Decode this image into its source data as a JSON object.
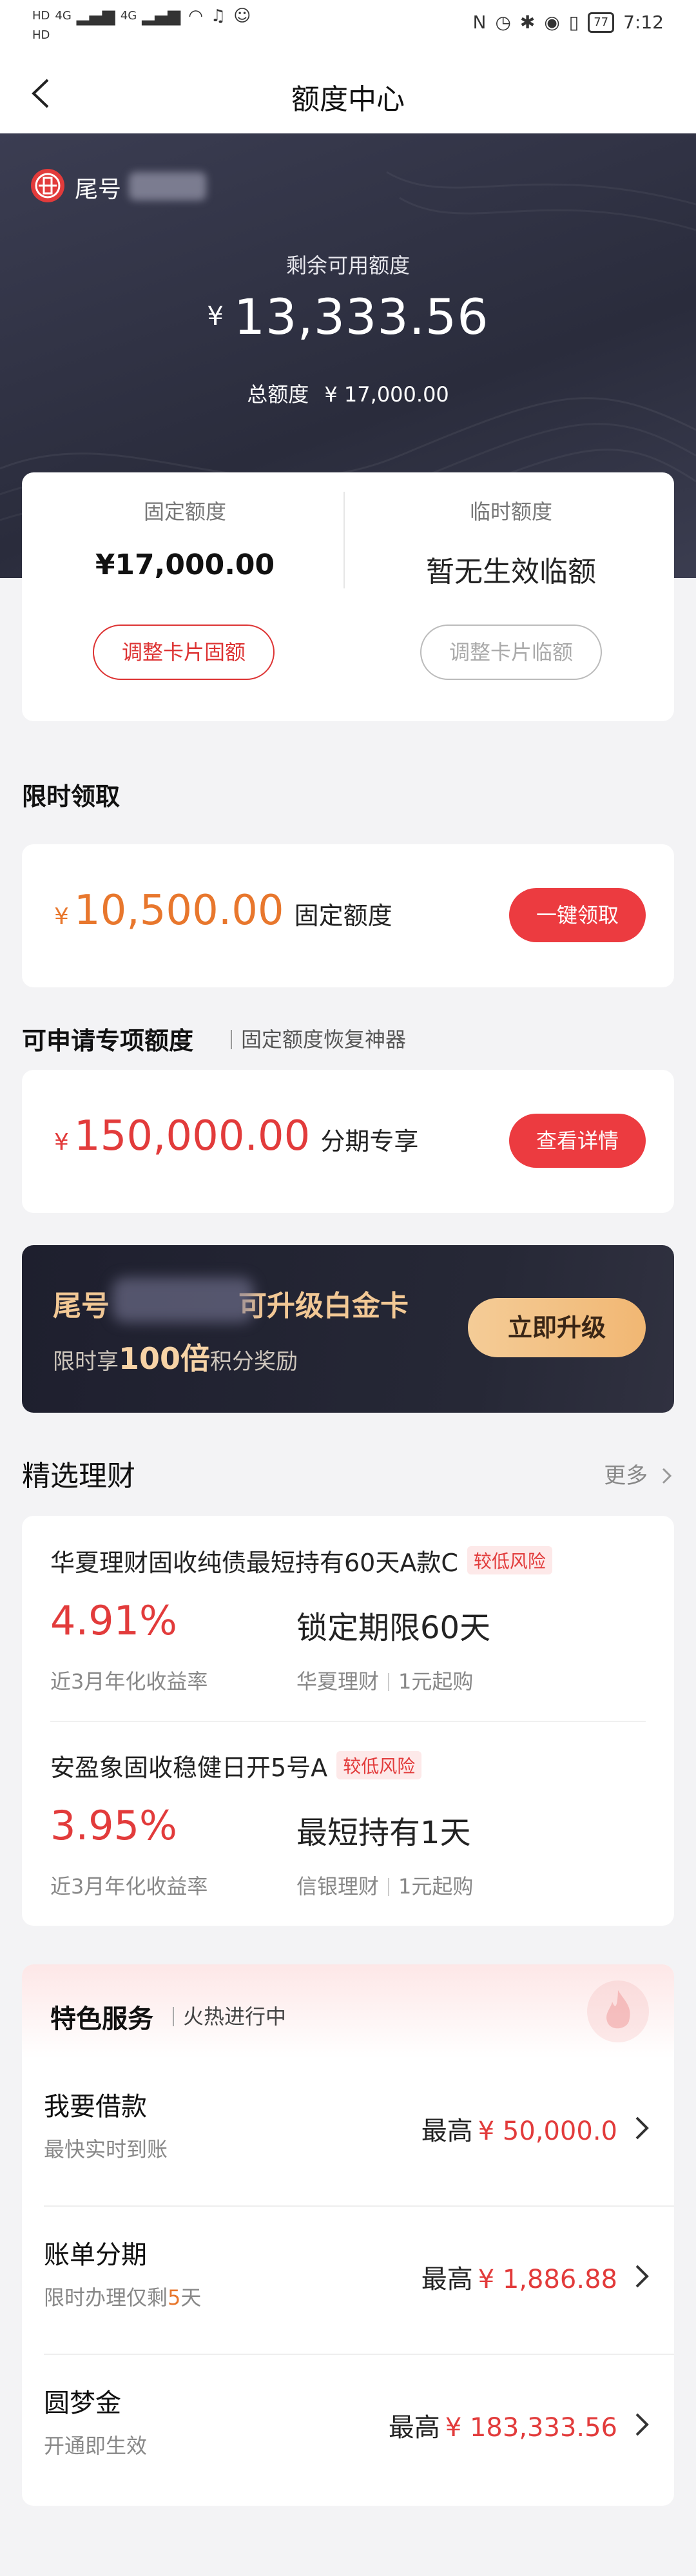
{
  "status_bar": {
    "network_labels": [
      "HD",
      "HD",
      "4G",
      "4G"
    ],
    "time": "7:12",
    "battery": "77"
  },
  "nav": {
    "title": "额度中心"
  },
  "hero": {
    "card_tail_prefix": "尾号",
    "remaining_label": "剩余可用额度",
    "currency": "¥",
    "remaining_amount": "13,333.56",
    "total_label": "总额度",
    "total_amount": "¥ 17,000.00"
  },
  "limits": {
    "fixed": {
      "label": "固定额度",
      "value": "¥17,000.00",
      "button": "调整卡片固额"
    },
    "temporary": {
      "label": "临时额度",
      "value": "暂无生效临额",
      "button": "调整卡片临额"
    }
  },
  "limited_time": {
    "title": "限时领取",
    "currency": "¥",
    "amount": "10,500.00",
    "desc": "固定额度",
    "button": "一键领取"
  },
  "special_quota": {
    "title": "可申请专项额度",
    "subtitle": "固定额度恢复神器",
    "currency": "¥",
    "amount": "150,000.00",
    "desc": "分期专享",
    "button": "查看详情"
  },
  "banner": {
    "title_prefix": "尾号",
    "title_suffix": "可升级白金卡",
    "sub_prefix": "限时享",
    "sub_bold": "100倍",
    "sub_suffix": "积分奖励",
    "button": "立即升级"
  },
  "wealth": {
    "title": "精选理财",
    "more": "更多",
    "products": [
      {
        "name": "华夏理财固收纯债最短持有60天A款C",
        "risk": "较低风险",
        "rate": "4.91%",
        "rate_label": "近3月年化收益率",
        "term": "锁定期限60天",
        "issuer": "华夏理财",
        "min": "1元起购"
      },
      {
        "name": "安盈象固收稳健日开5号A",
        "risk": "较低风险",
        "rate": "3.95%",
        "rate_label": "近3月年化收益率",
        "term": "最短持有1天",
        "issuer": "信银理财",
        "min": "1元起购"
      }
    ]
  },
  "services": {
    "title": "特色服务",
    "subtitle": "火热进行中",
    "items": [
      {
        "name": "我要借款",
        "desc": "最快实时到账",
        "prefix": "最高",
        "amount": "¥ 50,000.0"
      },
      {
        "name": "账单分期",
        "desc_pre": "限时办理仅剩",
        "desc_hl": "5",
        "desc_post": "天",
        "prefix": "最高",
        "amount": "¥ 1,886.88"
      },
      {
        "name": "圆梦金",
        "desc": "开通即生效",
        "prefix": "最高",
        "amount": "¥ 183,333.56"
      }
    ]
  },
  "colors": {
    "accent_red": "#e23b3b",
    "accent_orange": "#e8772d",
    "gold": "#f2c895",
    "hero_bg": "#2f3142"
  }
}
